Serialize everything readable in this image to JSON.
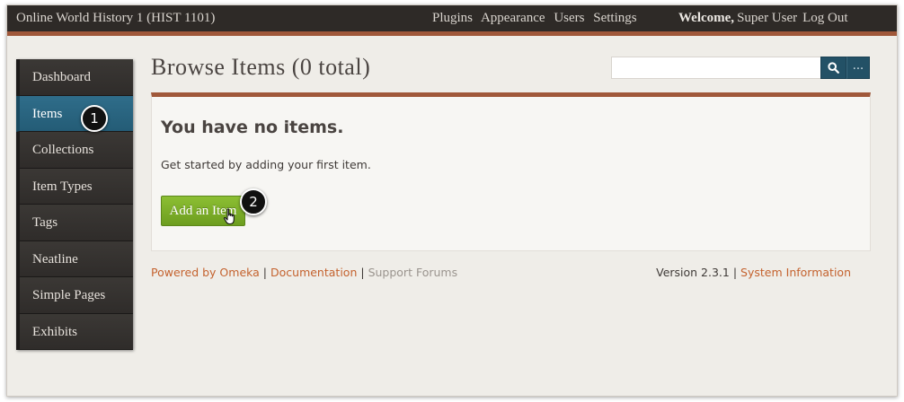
{
  "header": {
    "site_title": "Online World History 1 (HIST 1101)",
    "nav": [
      "Plugins",
      "Appearance",
      "Users",
      "Settings"
    ],
    "welcome_label": "Welcome,",
    "user_name": "Super User",
    "logout_label": "Log Out"
  },
  "sidebar": {
    "items": [
      {
        "label": "Dashboard",
        "active": false
      },
      {
        "label": "Items",
        "active": true
      },
      {
        "label": "Collections",
        "active": false
      },
      {
        "label": "Item Types",
        "active": false
      },
      {
        "label": "Tags",
        "active": false
      },
      {
        "label": "Neatline",
        "active": false
      },
      {
        "label": "Simple Pages",
        "active": false
      },
      {
        "label": "Exhibits",
        "active": false
      }
    ]
  },
  "main": {
    "title": "Browse Items (0 total)",
    "search": {
      "value": "",
      "placeholder": "",
      "search_icon": "search-icon",
      "advanced_label": "..."
    },
    "empty_heading": "You have no items.",
    "empty_text": "Get started by adding your first item.",
    "add_button_label": "Add an Item"
  },
  "callouts": [
    "1",
    "2"
  ],
  "footer": {
    "powered_by": "Powered by Omeka",
    "separator": "|",
    "documentation": "Documentation",
    "support_forums": "Support Forums",
    "version": "Version 2.3.1",
    "system_information": "System Information"
  },
  "colors": {
    "topbar": "#2e2a27",
    "accent_rust": "#a0583a",
    "active_nav": "#2f6d8a",
    "add_button": "#7bae28",
    "link": "#c4622e",
    "search_button": "#235166"
  }
}
